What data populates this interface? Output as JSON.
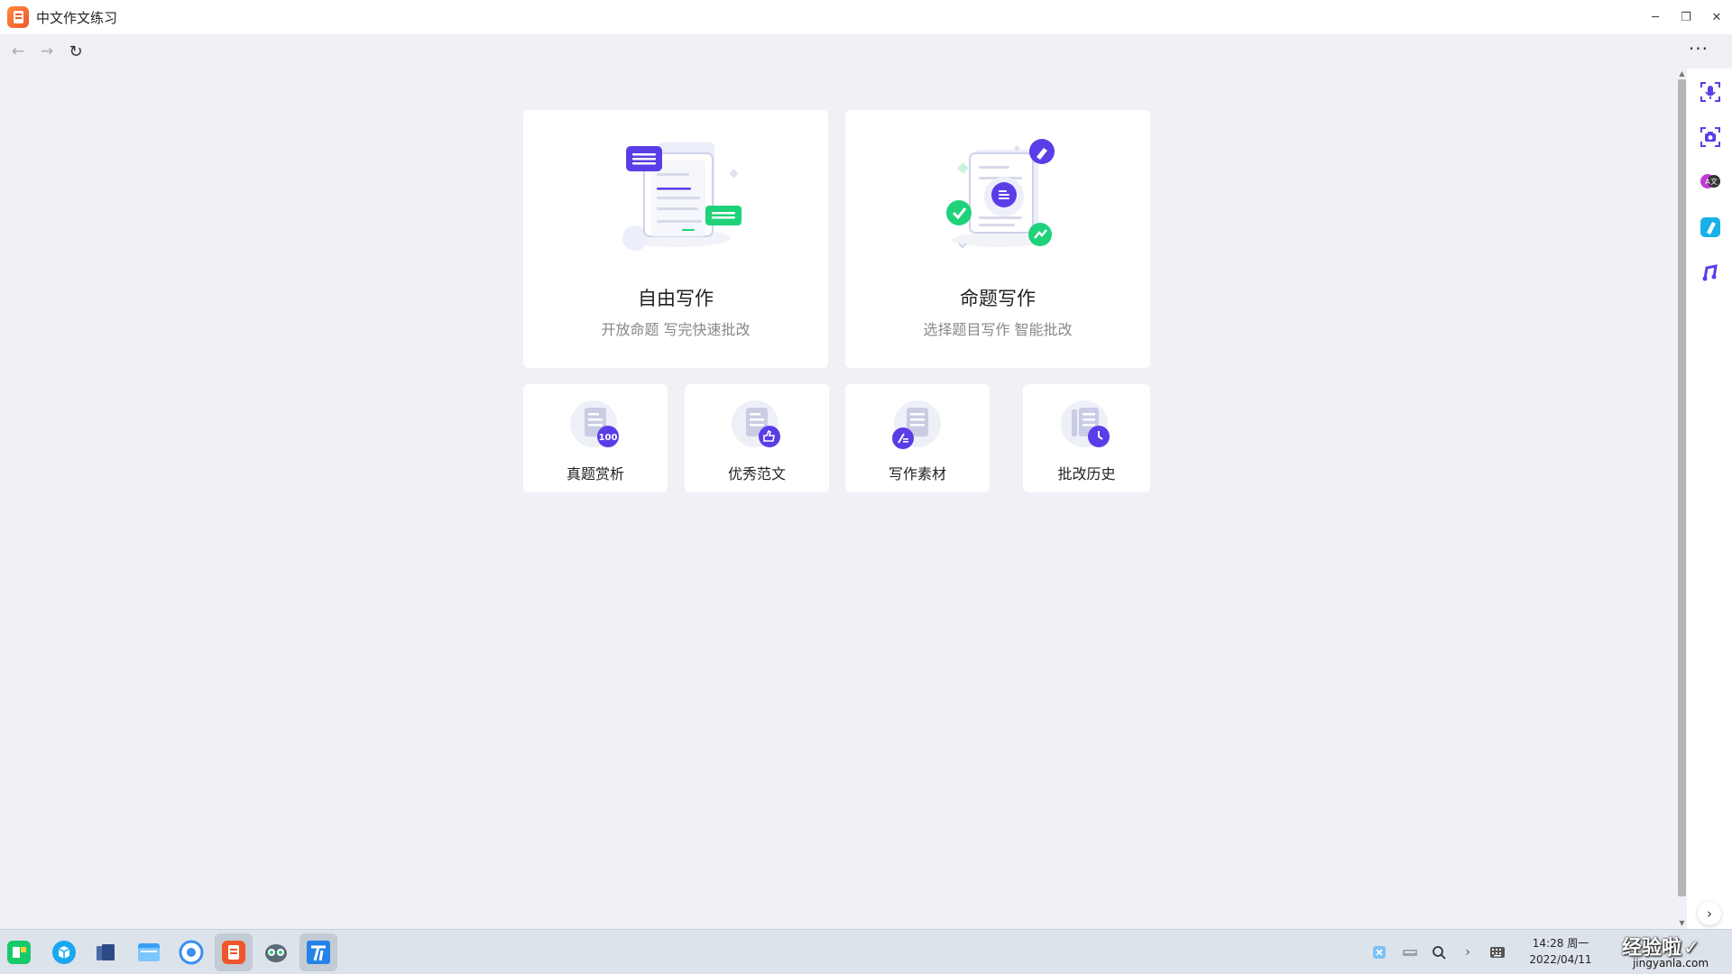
{
  "window": {
    "title": "中文作文练习",
    "minimize": "─",
    "maximize": "❐",
    "close": "✕"
  },
  "nav": {
    "back": "←",
    "forward": "→",
    "reload": "↻",
    "more": "···"
  },
  "main_cards": [
    {
      "title": "自由写作",
      "subtitle": "开放命题 写完快速批改"
    },
    {
      "title": "命题写作",
      "subtitle": "选择题目写作 智能批改"
    }
  ],
  "small_cards": [
    {
      "label": "真题赏析",
      "badge": "100"
    },
    {
      "label": "优秀范文"
    },
    {
      "label": "写作素材"
    },
    {
      "label": "批改历史"
    }
  ],
  "right_panel": {
    "items": [
      "voice-capture-icon",
      "camera-capture-icon",
      "translate-icon",
      "pen-icon",
      "music-icon"
    ],
    "expand": "›"
  },
  "taskbar": {
    "time": "14:28 周一",
    "date": "2022/04/11",
    "chevron": "›"
  },
  "watermark": {
    "text": "经验啦",
    "check": "✓",
    "url": "jingyanla.com"
  },
  "colors": {
    "accent": "#5b3de8",
    "green": "#1fd27a",
    "background": "#f0f1f6",
    "app_orange": "#f0562a"
  }
}
